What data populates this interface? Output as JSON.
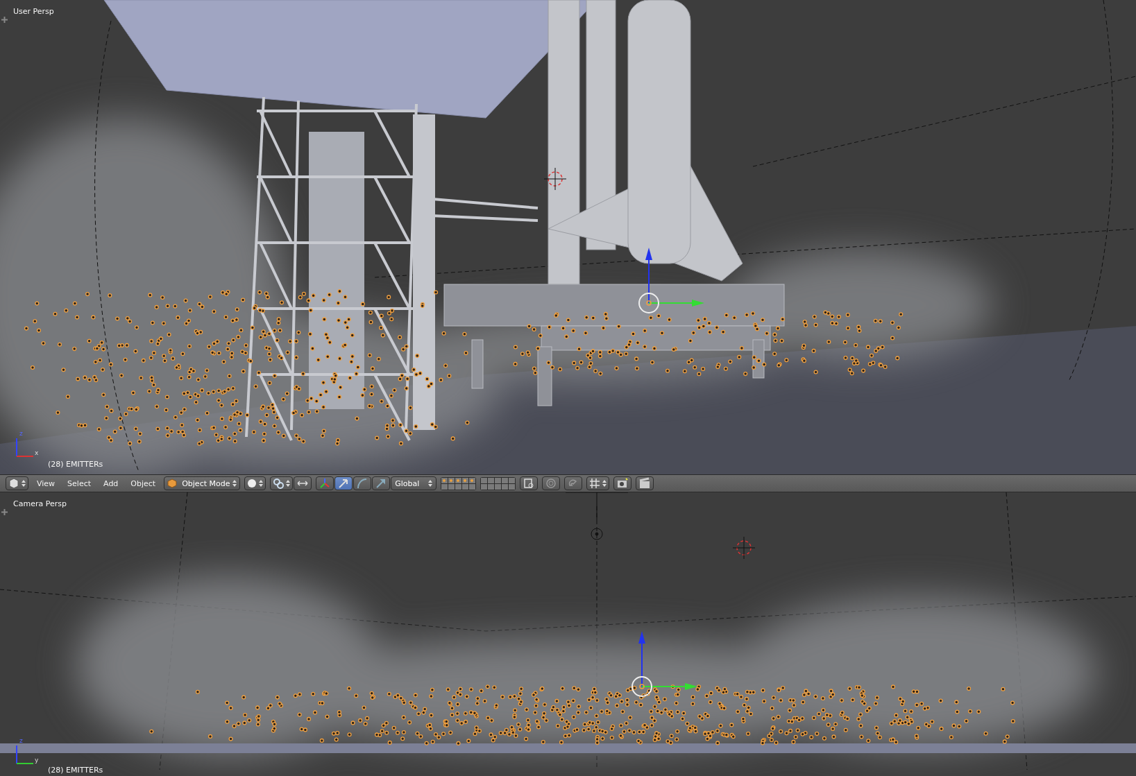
{
  "viewports": [
    {
      "label": "User Persp",
      "status": "(28) EMITTERs",
      "axes": [
        "z",
        "x"
      ]
    },
    {
      "label": "Camera Persp",
      "status": "(28) EMITTERs",
      "axes": [
        "z",
        "y"
      ]
    }
  ],
  "header": {
    "menus": [
      "View",
      "Select",
      "Add",
      "Object"
    ],
    "mode": "Object Mode",
    "orientation": "Global",
    "manipulators": [
      {
        "kind": "axes",
        "selected": false
      },
      {
        "kind": "translate",
        "selected": true
      },
      {
        "kind": "rotate",
        "selected": false
      },
      {
        "kind": "scale",
        "selected": false
      }
    ]
  }
}
